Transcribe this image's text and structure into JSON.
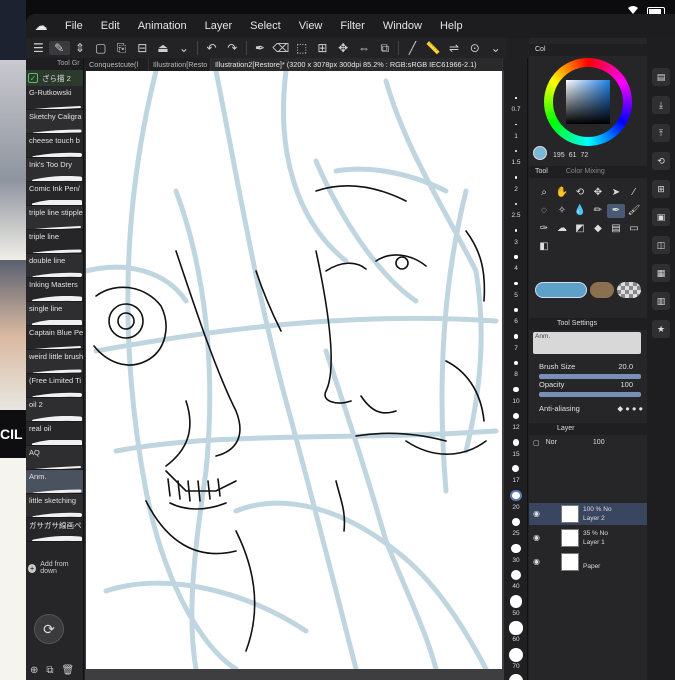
{
  "menu": {
    "logo": "☁",
    "items": [
      "File",
      "Edit",
      "Animation",
      "Layer",
      "Select",
      "View",
      "Filter",
      "Window",
      "Help"
    ]
  },
  "subtool": {
    "header": "Tool Gr",
    "current": "ざら描 2",
    "brushes": [
      "G-Rutkowski",
      "Sketchy Caligra",
      "cheese touch b",
      "Ink's Too Dry",
      "Comic Ink Pen/",
      "triple line stipple",
      "triple line",
      "double line",
      "Inking Masters",
      "single line",
      "Captain Blue Pe",
      "weird little brush",
      "(Free Limited Ti",
      "oil 2",
      "real oil",
      "AQ",
      "Anm.",
      "little sketching",
      "ガサガサ線画ペ"
    ],
    "selected_index": 16,
    "add_label": "Add from down"
  },
  "tabs": [
    {
      "label": "Conquestcute(l"
    },
    {
      "label": "Illustration[Resto"
    },
    {
      "label": "Illustration2[Restore]* (3200 x 3078px 300dpi 85.2% : RGB:sRGB IEC61966-2.1)"
    }
  ],
  "brush_sizes": [
    "0.7",
    "1",
    "1.5",
    "2",
    "2.5",
    "3",
    "4",
    "5",
    "6",
    "7",
    "8",
    "10",
    "12",
    "15",
    "17",
    "20",
    "25",
    "30",
    "40",
    "50",
    "60",
    "70",
    "80"
  ],
  "color": {
    "tab_label": "Col",
    "h": "195",
    "s": "61",
    "v": "72",
    "main_color": "#7ab6d6"
  },
  "tool_panel": {
    "tool_tab": "Tool",
    "mixing_tab": "Color Mixing"
  },
  "tool_settings": {
    "header": "Tool Settings",
    "preset": "Anm.",
    "brush_size_label": "Brush Size",
    "brush_size_value": "20.0",
    "opacity_label": "Opacity",
    "opacity_value": "100",
    "antialias_label": "Anti-aliasing"
  },
  "layer_panel": {
    "header": "Layer",
    "blend": "Nor",
    "opacity": "100",
    "layers": [
      {
        "opacity": "100 %",
        "mode": "No",
        "name": "Layer 2",
        "selected": true
      },
      {
        "opacity": "35 %",
        "mode": "No",
        "name": "Layer 1",
        "selected": false
      },
      {
        "opacity": "",
        "mode": "",
        "name": "Paper",
        "selected": false
      }
    ]
  },
  "background_app": {
    "text": "CIL"
  },
  "status": {
    "wifi": "wifi-icon",
    "battery": "battery-icon"
  }
}
